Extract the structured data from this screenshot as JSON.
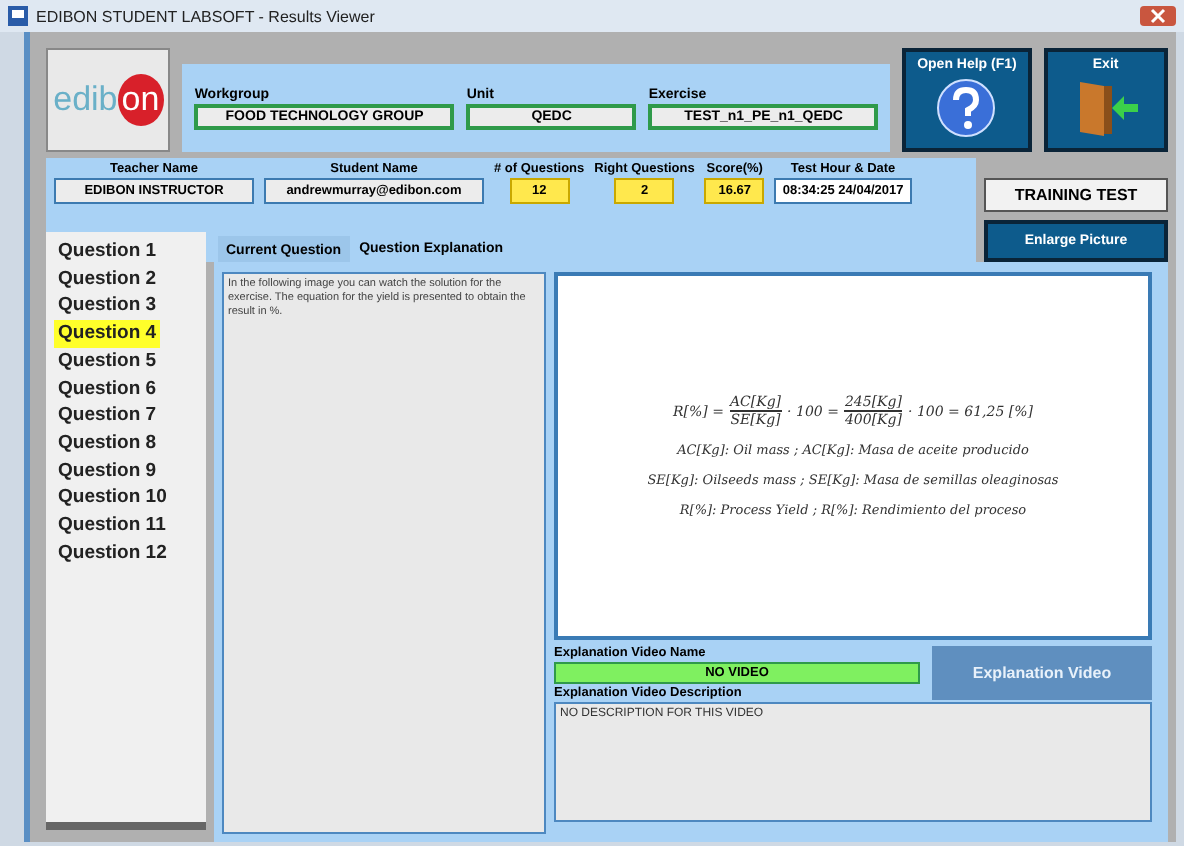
{
  "window": {
    "title": "EDIBON STUDENT LABSOFT - Results Viewer"
  },
  "logo": {
    "left": "edib",
    "right": "on"
  },
  "header_fields": [
    {
      "label": "Workgroup",
      "value": "FOOD TECHNOLOGY GROUP",
      "kind": "wide"
    },
    {
      "label": "Unit",
      "value": "QEDC",
      "kind": "mid"
    },
    {
      "label": "Exercise",
      "value": "TEST_n1_PE_n1_QEDC",
      "kind": "mid"
    }
  ],
  "help_button": {
    "label": "Open Help (F1)"
  },
  "exit_button": {
    "label": "Exit"
  },
  "info_fields": [
    {
      "label": "Teacher Name",
      "value": "EDIBON INSTRUCTOR",
      "kind": "text"
    },
    {
      "label": "Student Name",
      "value": "andrewmurray@edibon.com",
      "kind": "text"
    },
    {
      "label": "# of Questions",
      "value": "12",
      "kind": "number"
    },
    {
      "label": "Right Questions",
      "value": "2",
      "kind": "number"
    },
    {
      "label": "Score(%)",
      "value": "16.67",
      "kind": "number"
    },
    {
      "label": "Test Hour & Date",
      "value": "08:34:25 24/04/2017",
      "kind": "date"
    }
  ],
  "training_test_button": {
    "label": "TRAINING TEST"
  },
  "enlarge_button": {
    "label": "Enlarge Picture"
  },
  "questions": [
    {
      "label": "Question 1",
      "selected": false
    },
    {
      "label": "Question 2",
      "selected": false
    },
    {
      "label": "Question 3",
      "selected": false
    },
    {
      "label": "Question 4",
      "selected": true
    },
    {
      "label": "Question 5",
      "selected": false
    },
    {
      "label": "Question 6",
      "selected": false
    },
    {
      "label": "Question 7",
      "selected": false
    },
    {
      "label": "Question 8",
      "selected": false
    },
    {
      "label": "Question 9",
      "selected": false
    },
    {
      "label": "Question 10",
      "selected": false
    },
    {
      "label": "Question 11",
      "selected": false
    },
    {
      "label": "Question 12",
      "selected": false
    }
  ],
  "tabs": [
    {
      "label": "Current Question",
      "selected": false
    },
    {
      "label": "Question Explanation",
      "selected": true
    }
  ],
  "explanation_text": "In the following image you can watch the solution for the exercise. The equation for the yield is presented to obtain the result in %.",
  "formula": {
    "lhs": "R[%] =",
    "fraction_1": {
      "numerator": "AC[Kg]",
      "denominator": "SE[Kg]"
    },
    "middle": "· 100 =",
    "fraction_2": {
      "numerator": "245[Kg]",
      "denominator": "400[Kg]"
    },
    "rhs": "· 100 = 61,25 [%]"
  },
  "legend": [
    "AC[Kg]: Oil mass ; AC[Kg]: Masa de aceite producido",
    "SE[Kg]: Oilseeds mass ; SE[Kg]: Masa de semillas oleaginosas",
    "R[%]: Process Yield ; R[%]: Rendimiento del proceso"
  ],
  "video_name": {
    "label": "Explanation Video Name",
    "value": "NO VIDEO"
  },
  "video_button": {
    "label": "Explanation Video",
    "disabled": true
  },
  "video_description": {
    "label": "Explanation Video Description",
    "value": "NO DESCRIPTION FOR THIS VIDEO"
  }
}
